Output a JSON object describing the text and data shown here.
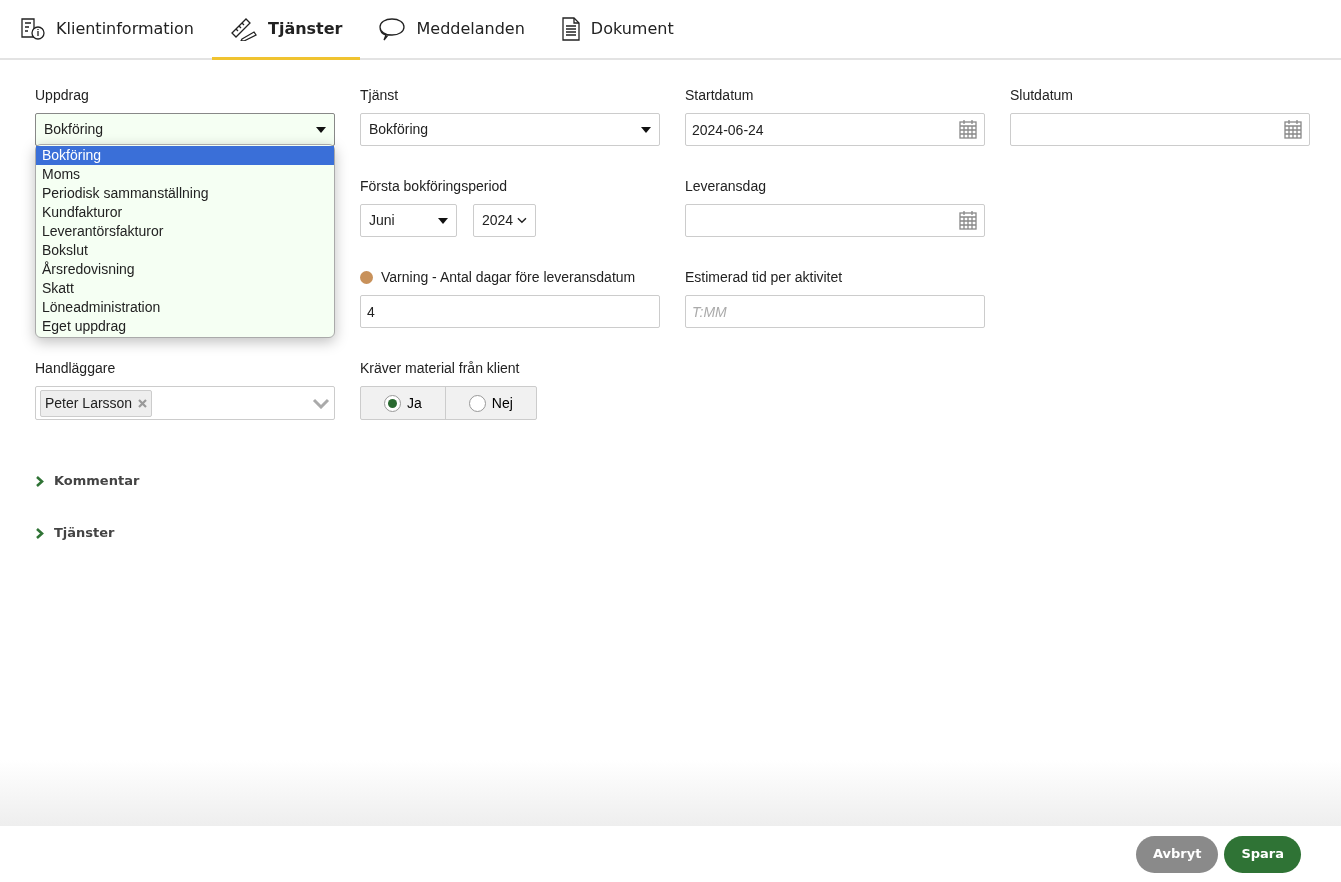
{
  "tabs": [
    {
      "label": "Klientinformation",
      "kind": "info",
      "selected": false
    },
    {
      "label": "Tjänster",
      "kind": "tools",
      "selected": true
    },
    {
      "label": "Meddelanden",
      "kind": "chat",
      "selected": false
    },
    {
      "label": "Dokument",
      "kind": "document",
      "selected": false
    }
  ],
  "form": {
    "uppdrag": {
      "label": "Uppdrag",
      "value": "Bokföring",
      "open": true,
      "options": [
        {
          "label": "Bokföring",
          "selected": true
        },
        {
          "label": "Moms",
          "selected": false
        },
        {
          "label": "Periodisk sammanställning",
          "selected": false
        },
        {
          "label": "Kundfakturor",
          "selected": false
        },
        {
          "label": "Leverantörsfakturor",
          "selected": false
        },
        {
          "label": "Bokslut",
          "selected": false
        },
        {
          "label": "Årsredovisning",
          "selected": false
        },
        {
          "label": "Skatt",
          "selected": false
        },
        {
          "label": "Löneadministration",
          "selected": false
        },
        {
          "label": "Eget uppdrag",
          "selected": false
        }
      ]
    },
    "tjanst": {
      "label": "Tjänst",
      "value": "Bokföring"
    },
    "startdatum": {
      "label": "Startdatum",
      "value": "2024-06-24"
    },
    "slutdatum": {
      "label": "Slutdatum"
    },
    "period": {
      "label": "Första bokföringsperiod",
      "month": "Juni",
      "year": "2024"
    },
    "leveransdag": {
      "label": "Leveransdag"
    },
    "varning": {
      "label": "Varning - Antal dagar före leveransdatum",
      "value": "4",
      "color": "#c8915a"
    },
    "estimerad": {
      "label": "Estimerad tid per aktivitet",
      "placeholder": "T:MM"
    },
    "handlaggare": {
      "label": "Handläggare",
      "tags": [
        "Peter Larsson"
      ]
    },
    "material": {
      "label": "Kräver material från klient",
      "options": [
        {
          "label": "Ja",
          "selected": true
        },
        {
          "label": "Nej",
          "selected": false
        }
      ]
    }
  },
  "sections": [
    {
      "label": "Kommentar",
      "expanded": false
    },
    {
      "label": "Tjänster",
      "expanded": false
    }
  ],
  "buttons": [
    {
      "label": "Avbryt",
      "kind": "secondary"
    },
    {
      "label": "Spara",
      "kind": "primary"
    }
  ]
}
